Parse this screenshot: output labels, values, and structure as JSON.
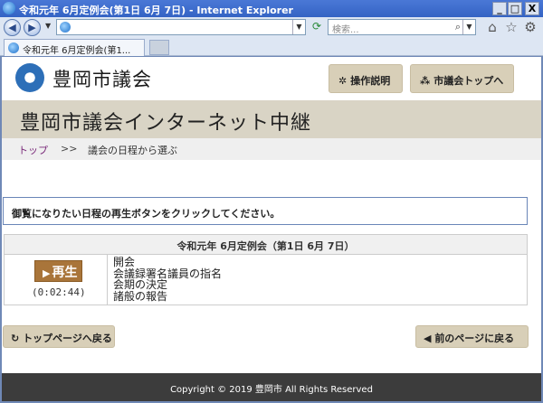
{
  "browser": {
    "window_title": "令和元年 6月定例会(第1日 6月 7日) - Internet Explorer",
    "search_placeholder": "検索...",
    "tab_label": "令和元年 6月定例会(第1...",
    "buttons": {
      "minimize": "_",
      "maximize": "□",
      "close": "X"
    },
    "icons": {
      "back": "back-icon",
      "forward": "forward-icon",
      "refresh": "refresh-icon",
      "search": "search-icon",
      "home": "home-icon",
      "favorites": "star-icon",
      "tools": "gear-icon"
    }
  },
  "site": {
    "name": "豊岡市議会",
    "manual_button": "操作説明",
    "council_top_button": "市議会トップへ",
    "banner_title": "豊岡市議会インターネット中継"
  },
  "breadcrumb": {
    "home": "トップ",
    "separator": ">>",
    "current": "議会の日程から選ぶ"
  },
  "instruction": "御覧になりたい日程の再生ボタンをクリックしてください。",
  "schedule": {
    "header": "令和元年 6月定例会（第1日 6月 7日）",
    "rows": [
      {
        "play_label": "再生",
        "duration": "(0:02:44)",
        "items": [
          "開会",
          "会議録署名議員の指名",
          "会期の決定",
          "諸般の報告"
        ]
      }
    ]
  },
  "footer_buttons": {
    "back_top": "トップページへ戻る",
    "prev_page": "前のページに戻る"
  },
  "footer": "Copyright © 2019 豊岡市 All Rights Reserved",
  "colors": {
    "title_bar": "#3463c4",
    "banner": "#d9d4c5",
    "button_beige": "#d8cfb8",
    "play_button": "#a9753a",
    "footer": "#3c3c3c",
    "breadcrumb_link": "#7a2a7a"
  }
}
